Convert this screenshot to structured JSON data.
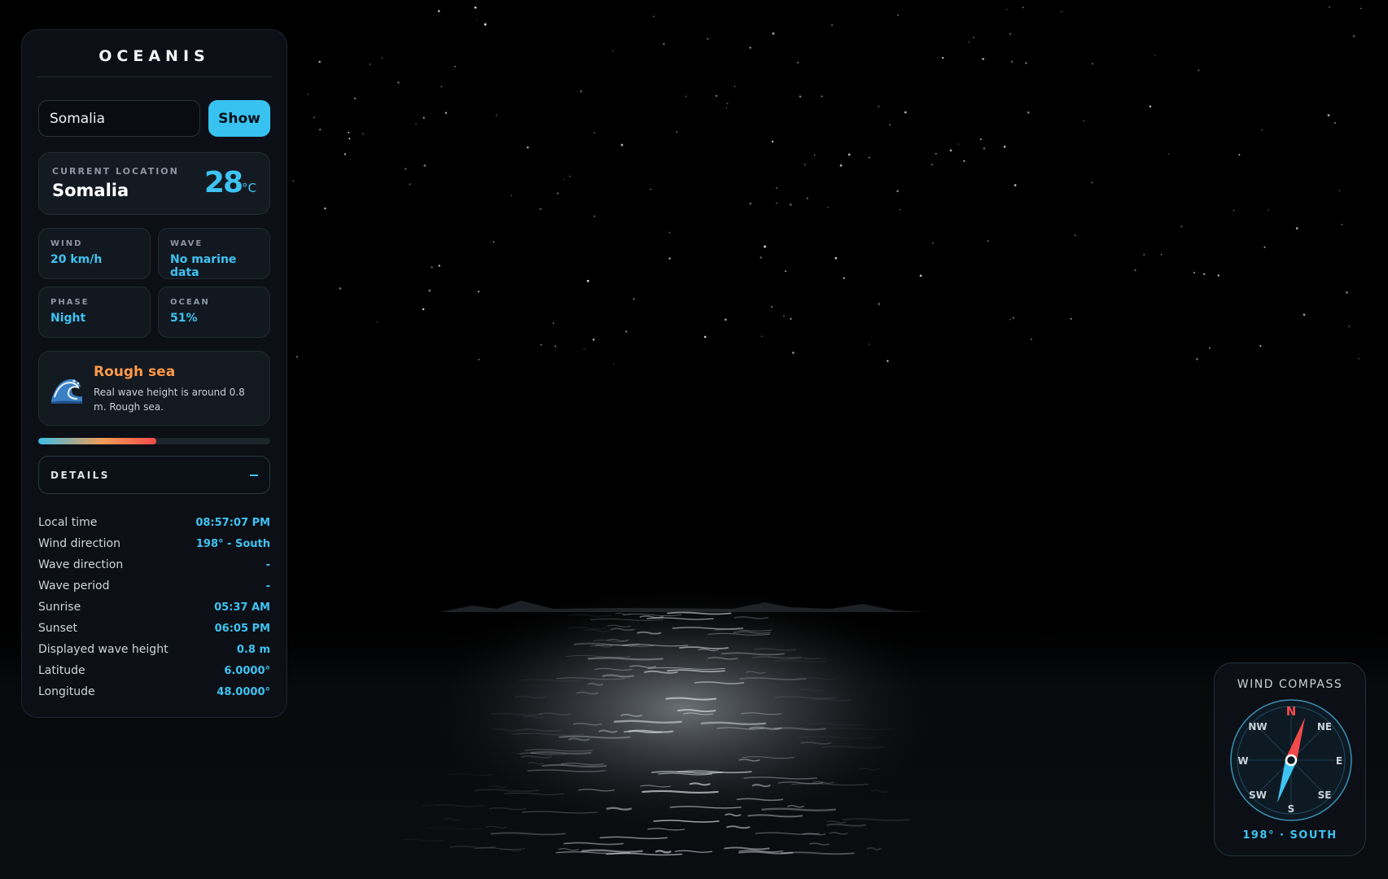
{
  "app": {
    "title": "OCEANIS"
  },
  "search": {
    "value": "Somalia",
    "button_label": "Show"
  },
  "location": {
    "caption": "CURRENT LOCATION",
    "name": "Somalia",
    "temp": "28",
    "temp_unit": "°C"
  },
  "stats": [
    {
      "label": "WIND",
      "value": "20 km/h"
    },
    {
      "label": "WAVE",
      "value": "No marine data"
    },
    {
      "label": "PHASE",
      "value": "Night"
    },
    {
      "label": "OCEAN",
      "value": "51%"
    }
  ],
  "sea_state": {
    "icon": "wave-emoji-icon",
    "title": "Rough sea",
    "description": "Real wave height is around 0.8 m. Rough sea.",
    "level": 0.51
  },
  "details": {
    "toggle_label": "DETAILS",
    "rows": [
      {
        "label": "Local time",
        "value": "08:57:07 PM"
      },
      {
        "label": "Wind direction",
        "value": "198° - South"
      },
      {
        "label": "Wave direction",
        "value": "-"
      },
      {
        "label": "Wave period",
        "value": "-"
      },
      {
        "label": "Sunrise",
        "value": "05:37 AM"
      },
      {
        "label": "Sunset",
        "value": "06:05 PM"
      },
      {
        "label": "Displayed wave height",
        "value": "0.8 m"
      },
      {
        "label": "Latitude",
        "value": "6.0000°"
      },
      {
        "label": "Longitude",
        "value": "48.0000°"
      }
    ]
  },
  "compass": {
    "title": "WIND COMPASS",
    "labels": {
      "n": "N",
      "ne": "NE",
      "e": "E",
      "se": "SE",
      "s": "S",
      "sw": "SW",
      "w": "W",
      "nw": "NW"
    },
    "reading": "198° · SOUTH",
    "needle_degrees": 198
  },
  "colors": {
    "accent": "#3ec3f2",
    "warning": "#ff9a4a",
    "north": "#f24a4a",
    "background": "#000000"
  }
}
